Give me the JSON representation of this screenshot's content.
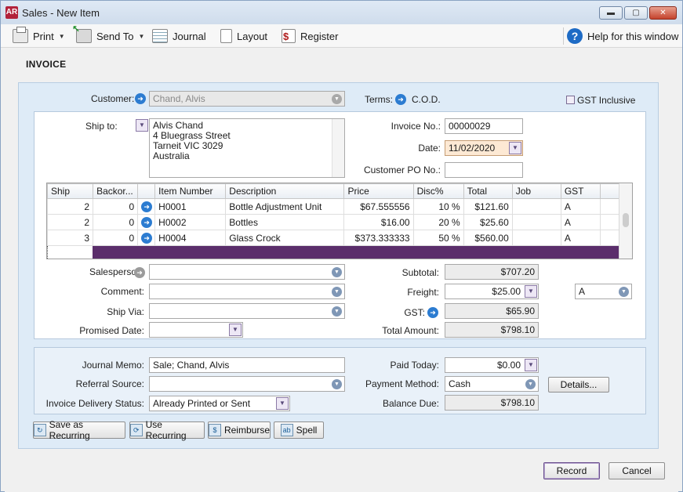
{
  "window": {
    "app_badge": "AR",
    "title": "Sales - New Item",
    "minimize": "▬",
    "maximize": "▢",
    "close": "✕"
  },
  "toolbar": {
    "print": "Print",
    "send_to": "Send To",
    "journal": "Journal",
    "layout": "Layout",
    "register": "Register",
    "help": "Help for this window",
    "help_icon": "?"
  },
  "invoice": {
    "heading": "INVOICE",
    "customer_label": "Customer:",
    "customer_value": "Chand, Alvis",
    "terms_label": "Terms:",
    "terms_value": "C.O.D.",
    "gst_inclusive_label": "GST Inclusive",
    "gst_inclusive": false,
    "ship_to_label": "Ship to:",
    "ship_to_lines": [
      "Alvis Chand",
      "4 Bluegrass Street",
      "Tarneit  VIC  3029",
      "Australia"
    ],
    "invoice_no_label": "Invoice No.:",
    "invoice_no": "00000029",
    "date_label": "Date:",
    "date": "11/02/2020",
    "customer_po_label": "Customer PO No.:",
    "customer_po": ""
  },
  "lines": {
    "columns": [
      "Ship",
      "Backor...",
      "",
      "Item Number",
      "Description",
      "Price",
      "Disc%",
      "Total",
      "Job",
      "GST"
    ],
    "rows": [
      {
        "ship": "2",
        "backorder": "0",
        "item": "H0001",
        "description": "Bottle Adjustment Unit",
        "price": "$67.555556",
        "disc": "10 %",
        "total": "$121.60",
        "job": "",
        "gst": "A"
      },
      {
        "ship": "2",
        "backorder": "0",
        "item": "H0002",
        "description": "Bottles",
        "price": "$16.00",
        "disc": "20 %",
        "total": "$25.60",
        "job": "",
        "gst": "A"
      },
      {
        "ship": "3",
        "backorder": "0",
        "item": "H0004",
        "description": "Glass Crock",
        "price": "$373.333333",
        "disc": "50 %",
        "total": "$560.00",
        "job": "",
        "gst": "A"
      }
    ]
  },
  "details": {
    "salesperson_label": "Salesperson:",
    "salesperson": "",
    "comment_label": "Comment:",
    "comment": "",
    "ship_via_label": "Ship Via:",
    "ship_via": "",
    "promised_date_label": "Promised Date:",
    "promised_date": "",
    "subtotal_label": "Subtotal:",
    "subtotal": "$707.20",
    "freight_label": "Freight:",
    "freight": "$25.00",
    "freight_tax_code": "A",
    "gst_label": "GST:",
    "gst": "$65.90",
    "total_label": "Total Amount:",
    "total": "$798.10"
  },
  "payment": {
    "journal_memo_label": "Journal Memo:",
    "journal_memo": "Sale; Chand, Alvis",
    "referral_label": "Referral Source:",
    "referral": "",
    "delivery_status_label": "Invoice Delivery Status:",
    "delivery_status": "Already Printed or Sent",
    "paid_today_label": "Paid Today:",
    "paid_today": "$0.00",
    "payment_method_label": "Payment Method:",
    "payment_method": "Cash",
    "details_button": "Details...",
    "balance_due_label": "Balance Due:",
    "balance_due": "$798.10"
  },
  "actions": {
    "save_recurring": "Save as Recurring",
    "use_recurring": "Use Recurring",
    "reimburse": "Reimburse",
    "spell": "Spell",
    "record": "Record",
    "cancel": "Cancel"
  },
  "colors": {
    "panel": "#deebf7",
    "selected_row": "#5b2e6b",
    "link_arrow": "#2c7cd1",
    "date_field": "#fde9d4"
  }
}
